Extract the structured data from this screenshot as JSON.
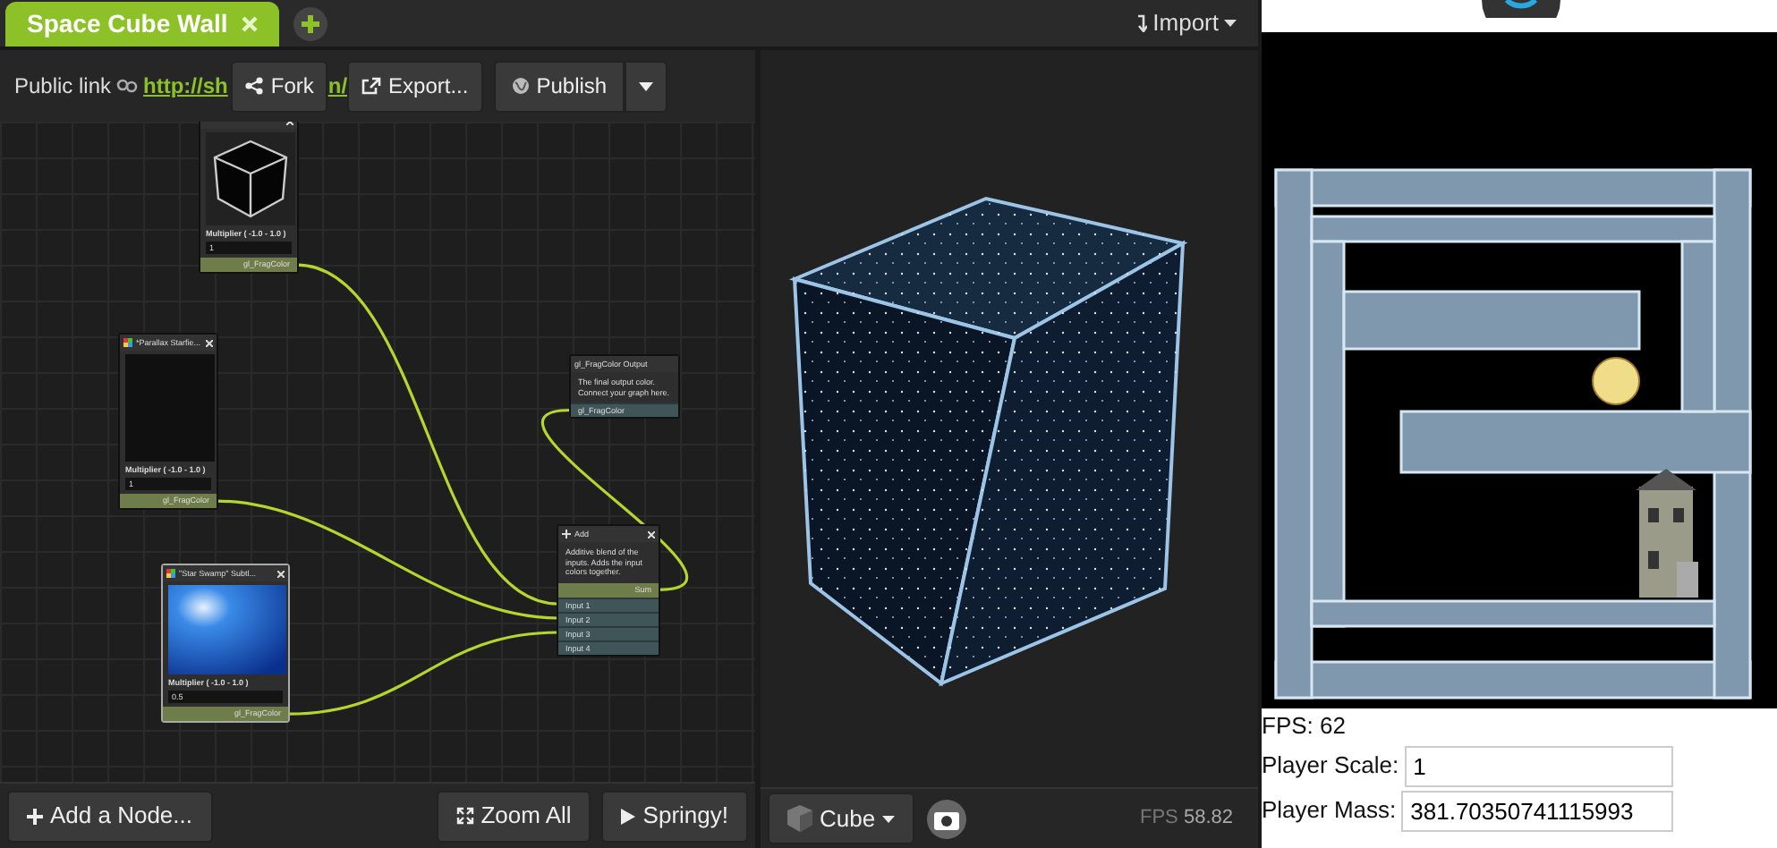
{
  "tabs": [
    {
      "label": "Space Cube Wall",
      "selected": true
    }
  ],
  "import_menu": {
    "label": "Import"
  },
  "toolbar": {
    "public_link_label": "Public link",
    "link_parts": [
      "http://sh",
      "n/"
    ],
    "fork": {
      "label": "Fork"
    },
    "export": {
      "label": "Export..."
    },
    "publish": {
      "label": "Publish"
    }
  },
  "graph": {
    "nodes": [
      {
        "kind": "input",
        "preview": {
          "kind": "cube"
        },
        "param_label": "Multiplier ( -1.0 - 1.0 )",
        "param_value": "1",
        "output": "gl_FragColor"
      },
      {
        "kind": "input",
        "title": "*Parallax Starfie...",
        "preview": {
          "kind": "dark"
        },
        "param_label": "Multiplier ( -1.0 - 1.0 )",
        "param_value": "1",
        "output": "gl_FragColor"
      },
      {
        "kind": "input",
        "title": "\"Star Swamp\" Subtl...",
        "preview": {
          "kind": "nebula"
        },
        "param_label": "Multiplier ( -1.0 - 1.0 )",
        "param_value": "0.5",
        "output": "gl_FragColor"
      },
      {
        "kind": "output",
        "title": "gl_FragColor Output",
        "description": "The final output color. Connect your graph here.",
        "inputs": [
          "gl_FragColor"
        ]
      },
      {
        "kind": "blend",
        "title": "Add",
        "description": "Additive blend of the inputs. Adds the input colors together.",
        "output": "Sum",
        "inputs": [
          "Input 1",
          "Input 2",
          "Input 3",
          "Input 4"
        ]
      }
    ],
    "buttons": [
      {
        "kind": "add",
        "label": "Add a Node..."
      },
      {
        "kind": "zoom",
        "label": "Zoom All"
      },
      {
        "kind": "play",
        "label": "Springy!"
      }
    ]
  },
  "viewer": {
    "shape": {
      "label": "Cube"
    },
    "fps_label": "FPS",
    "fps_value": "58.82"
  },
  "game": {
    "fps": "FPS: 62",
    "fields": [
      {
        "label": "Player Scale:",
        "value": "1"
      },
      {
        "label": "Player Mass:",
        "value": "381.70350741115993"
      }
    ]
  }
}
